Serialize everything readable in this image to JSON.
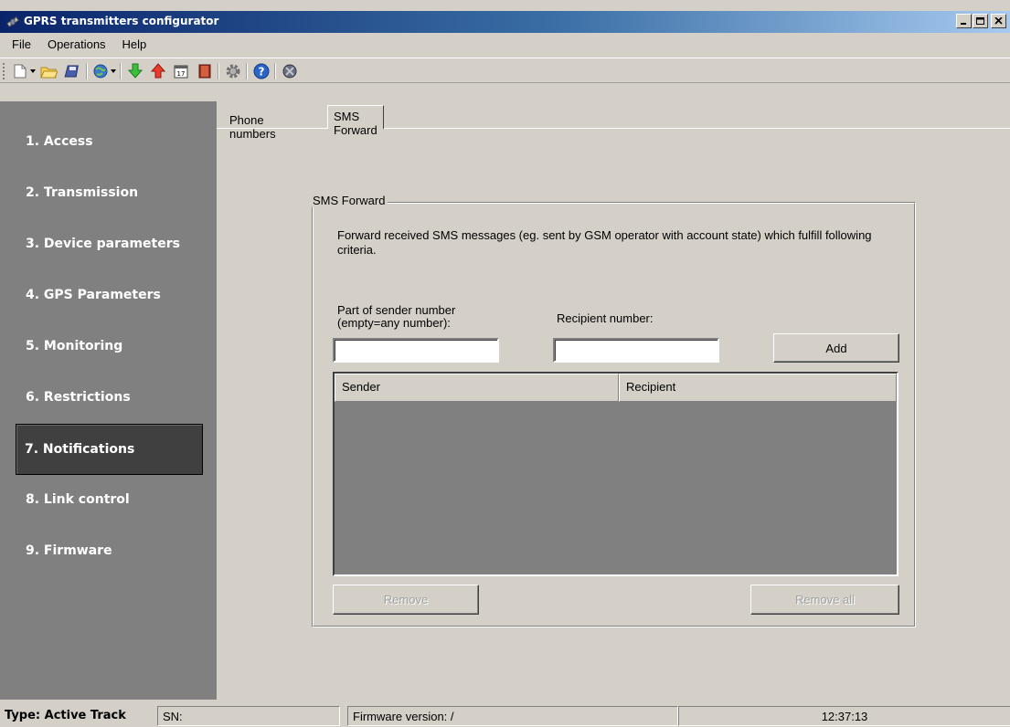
{
  "window": {
    "title": "GPRS transmitters configurator",
    "icon": "satellite-app-icon"
  },
  "menu": {
    "items": [
      "File",
      "Operations",
      "Help"
    ]
  },
  "toolbar": {
    "buttons": [
      "new-icon",
      "open-folder-icon",
      "save-icon",
      "connect-globe-icon",
      "download-green-arrow-icon",
      "upload-red-arrow-icon",
      "calendar-icon",
      "book-icon",
      "settings-gear-icon",
      "help-icon",
      "disconnect-icon"
    ]
  },
  "sidebar": {
    "items": [
      {
        "label": "1. Access"
      },
      {
        "label": "2. Transmission"
      },
      {
        "label": "3. Device parameters"
      },
      {
        "label": "4. GPS Parameters"
      },
      {
        "label": "5. Monitoring"
      },
      {
        "label": "6. Restrictions"
      },
      {
        "label": "7. Notifications"
      },
      {
        "label": "8. Link control"
      },
      {
        "label": "9. Firmware"
      }
    ],
    "active_index": 6
  },
  "tabs": {
    "items": [
      "Phone numbers",
      "SMS Forward"
    ],
    "selected": "SMS Forward"
  },
  "sms_forward": {
    "group_title": "SMS Forward",
    "description": "Forward received SMS messages (eg. sent by GSM operator with account state) which fulfill following criteria.",
    "sender_label_1": "Part of sender number",
    "sender_label_2": "(empty=any number):",
    "sender_value": "",
    "recipient_label": "Recipient number:",
    "recipient_value": "",
    "add_label": "Add",
    "columns": [
      "Sender",
      "Recipient"
    ],
    "rows": [],
    "remove_label": "Remove",
    "remove_all_label": "Remove all"
  },
  "status": {
    "type": "Type: Active Track",
    "sn": "SN:",
    "firmware": "Firmware version: /",
    "time": "12:37:13"
  }
}
